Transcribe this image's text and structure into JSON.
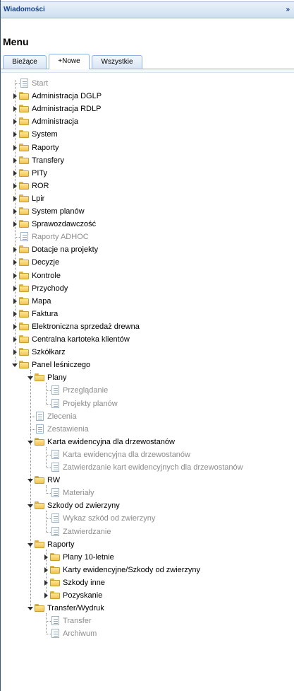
{
  "header": {
    "title": "Wiadomości",
    "collapse_label": "»"
  },
  "menu": {
    "title": "Menu"
  },
  "tabs": [
    {
      "label": "Bieżące"
    },
    {
      "label": "+Nowe"
    },
    {
      "label": "Wszystkie"
    }
  ],
  "tree": [
    {
      "label": "Start",
      "level": 0,
      "type": "leaf"
    },
    {
      "label": "Administracja DGLP",
      "level": 0,
      "type": "folder-collapsed"
    },
    {
      "label": "Administracja RDLP",
      "level": 0,
      "type": "folder-collapsed"
    },
    {
      "label": "Administracja",
      "level": 0,
      "type": "folder-collapsed"
    },
    {
      "label": "System",
      "level": 0,
      "type": "folder-collapsed"
    },
    {
      "label": "Raporty",
      "level": 0,
      "type": "folder-collapsed"
    },
    {
      "label": "Transfery",
      "level": 0,
      "type": "folder-collapsed"
    },
    {
      "label": "PITy",
      "level": 0,
      "type": "folder-collapsed"
    },
    {
      "label": "ROR",
      "level": 0,
      "type": "folder-collapsed"
    },
    {
      "label": "Lpir",
      "level": 0,
      "type": "folder-collapsed"
    },
    {
      "label": "System planów",
      "level": 0,
      "type": "folder-collapsed"
    },
    {
      "label": "Sprawozdawczość",
      "level": 0,
      "type": "folder-collapsed"
    },
    {
      "label": "Raporty ADHOC",
      "level": 0,
      "type": "leaf"
    },
    {
      "label": "Dotacje na projekty",
      "level": 0,
      "type": "folder-collapsed"
    },
    {
      "label": "Decyzje",
      "level": 0,
      "type": "folder-collapsed"
    },
    {
      "label": "Kontrole",
      "level": 0,
      "type": "folder-collapsed"
    },
    {
      "label": "Przychody",
      "level": 0,
      "type": "folder-collapsed"
    },
    {
      "label": "Mapa",
      "level": 0,
      "type": "folder-collapsed"
    },
    {
      "label": "Faktura",
      "level": 0,
      "type": "folder-collapsed"
    },
    {
      "label": "Elektroniczna sprzedaż drewna",
      "level": 0,
      "type": "folder-collapsed"
    },
    {
      "label": "Centralna kartoteka klientów",
      "level": 0,
      "type": "folder-collapsed"
    },
    {
      "label": "Szkółkarz",
      "level": 0,
      "type": "folder-collapsed"
    },
    {
      "label": "Panel leśniczego",
      "level": 0,
      "type": "folder-expanded"
    },
    {
      "label": "Plany",
      "level": 1,
      "type": "folder-expanded"
    },
    {
      "label": "Przeglądanie",
      "level": 2,
      "type": "leaf"
    },
    {
      "label": "Projekty planów",
      "level": 2,
      "type": "leaf"
    },
    {
      "label": "Zlecenia",
      "level": 1,
      "type": "leaf"
    },
    {
      "label": "Zestawienia",
      "level": 1,
      "type": "leaf"
    },
    {
      "label": "Karta ewidencyjna dla drzewostanów",
      "level": 1,
      "type": "folder-expanded"
    },
    {
      "label": "Karta ewidencyjna dla drzewostanów",
      "level": 2,
      "type": "leaf"
    },
    {
      "label": "Zatwierdzanie kart ewidencyjnych dla drzewostanów",
      "level": 2,
      "type": "leaf"
    },
    {
      "label": "RW",
      "level": 1,
      "type": "folder-expanded"
    },
    {
      "label": "Materiały",
      "level": 2,
      "type": "leaf"
    },
    {
      "label": "Szkody od zwierzyny",
      "level": 1,
      "type": "folder-expanded"
    },
    {
      "label": "Wykaz szkód od zwierzyny",
      "level": 2,
      "type": "leaf"
    },
    {
      "label": "Zatwierdzanie",
      "level": 2,
      "type": "leaf"
    },
    {
      "label": "Raporty",
      "level": 1,
      "type": "folder-expanded"
    },
    {
      "label": "Plany 10-letnie",
      "level": 2,
      "type": "folder-collapsed"
    },
    {
      "label": "Karty ewidencyjne/Szkody od zwierzyny",
      "level": 2,
      "type": "folder-collapsed"
    },
    {
      "label": "Szkody inne",
      "level": 2,
      "type": "folder-collapsed"
    },
    {
      "label": "Pozyskanie",
      "level": 2,
      "type": "folder-collapsed"
    },
    {
      "label": "Transfer/Wydruk",
      "level": 1,
      "type": "folder-expanded"
    },
    {
      "label": "Transfer",
      "level": 2,
      "type": "leaf"
    },
    {
      "label": "Archiwum",
      "level": 2,
      "type": "leaf"
    }
  ]
}
